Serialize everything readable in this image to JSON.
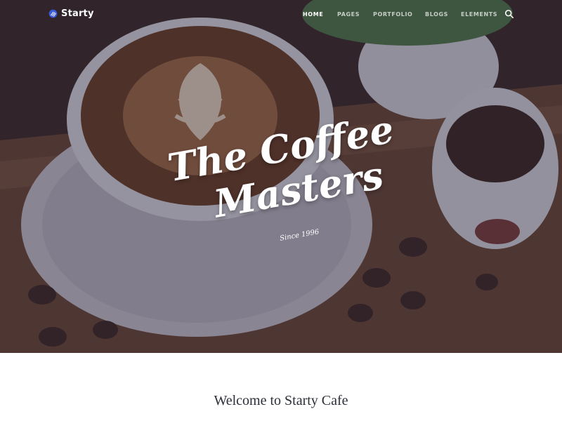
{
  "brand": {
    "name": "Starty"
  },
  "nav": {
    "items": [
      {
        "label": "HOME",
        "active": true
      },
      {
        "label": "PAGES",
        "active": false
      },
      {
        "label": "PORTFOLIO",
        "active": false
      },
      {
        "label": "BLOGS",
        "active": false
      },
      {
        "label": "ELEMENTS",
        "active": false
      }
    ],
    "search_icon": "search-icon"
  },
  "hero": {
    "title_line1": "The Coffee",
    "title_line2": "Masters",
    "since": "Since 1996"
  },
  "welcome": {
    "heading": "Welcome to Starty Cafe"
  },
  "colors": {
    "overlay": "#211e32",
    "logo_accent": "#3b5bdb",
    "text_dark": "#2c2f3a"
  }
}
